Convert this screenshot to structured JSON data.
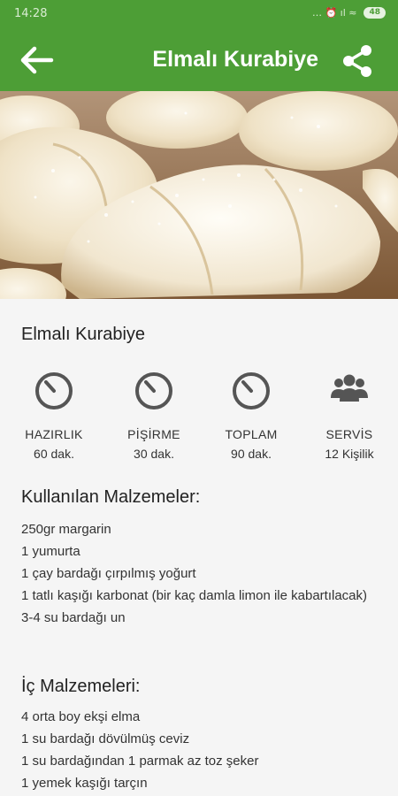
{
  "status_bar": {
    "time": "14:28",
    "indicators": "… ⏰ ıl ≈",
    "battery": "48"
  },
  "toolbar": {
    "title": "Elmalı Kurabiye",
    "back_icon": "arrow-back-icon",
    "share_icon": "share-icon",
    "background": "#4d9e36"
  },
  "recipe": {
    "title": "Elmalı Kurabiye",
    "stats": [
      {
        "label": "HAZIRLIK",
        "value": "60 dak.",
        "icon": "timer-icon"
      },
      {
        "label": "PİŞİRME",
        "value": "30 dak.",
        "icon": "timer-icon"
      },
      {
        "label": "TOPLAM",
        "value": "90 dak.",
        "icon": "timer-icon"
      },
      {
        "label": "SERVİS",
        "value": "12 Kişilik",
        "icon": "people-icon"
      }
    ],
    "ingredients_title": "Kullanılan Malzemeler:",
    "ingredients": [
      "250gr margarin",
      "1 yumurta",
      "1 çay bardağı çırpılmış yoğurt",
      "1 tatlı kaşığı karbonat (bir kaç damla limon ile kabartılacak)",
      "3-4 su bardağı un"
    ],
    "filling_title": "İç Malzemeleri:",
    "filling": [
      "4 orta boy ekşi elma",
      "1 su bardağı dövülmüş ceviz",
      "1 su bardağından 1 parmak az toz şeker",
      "1 yemek kaşığı tarçın"
    ]
  }
}
